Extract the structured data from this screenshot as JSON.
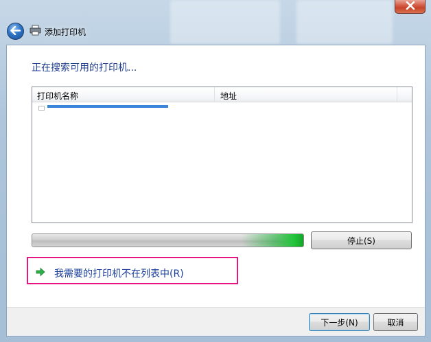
{
  "window": {
    "title": "添加打印机",
    "close_icon": "close-x-icon"
  },
  "main": {
    "heading": "正在搜索可用的打印机...",
    "list": {
      "columns": [
        {
          "label": "打印机名称"
        },
        {
          "label": "地址"
        }
      ]
    },
    "progress_percent": 100,
    "stop_button": "停止(S)",
    "missing_printer_link": "我需要的打印机不在列表中(R)"
  },
  "footer": {
    "next_button": "下一步(N)",
    "cancel_button": "取消"
  },
  "colors": {
    "heading": "#1e3c8c",
    "link": "#1a3e9a",
    "highlight_box": "#e6157f",
    "progress_glow": "#22c43a"
  }
}
